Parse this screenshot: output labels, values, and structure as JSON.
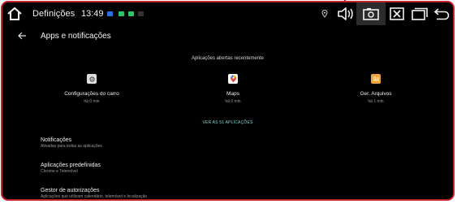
{
  "statusbar": {
    "title": "Definições",
    "time": "13:49",
    "notification_colors": [
      "#2a6ee0",
      "#2ec46a",
      "#2ec46a",
      "#333333"
    ],
    "right_icons": [
      "location-icon",
      "volume-icon",
      "screenshot-icon",
      "close-app-icon",
      "recents-icon",
      "back-icon"
    ]
  },
  "appbar": {
    "title": "Apps e notificações"
  },
  "recent": {
    "heading": "Aplicações abertas recentemente",
    "apps": [
      {
        "name": "Configurações do carro",
        "time": "há 0 min",
        "icon": "car-settings-icon",
        "color": "#dcdcdc"
      },
      {
        "name": "Maps",
        "time": "há 0 min",
        "icon": "maps-icon",
        "color": "#ffffff"
      },
      {
        "name": "Ger. Arquivos",
        "time": "há 1 min",
        "icon": "file-manager-icon",
        "color": "#f0a33a"
      }
    ],
    "see_all": "VER AS 51 APLICAÇÕES"
  },
  "items": [
    {
      "title": "Notificações",
      "subtitle": "Ativadas para todas as aplicações"
    },
    {
      "title": "Aplicações predefinidas",
      "subtitle": "Chrome e Telemóvel"
    },
    {
      "title": "Gestor de autorizações",
      "subtitle": "Aplicações que utilizam calendário, telemóvel e localização"
    }
  ]
}
